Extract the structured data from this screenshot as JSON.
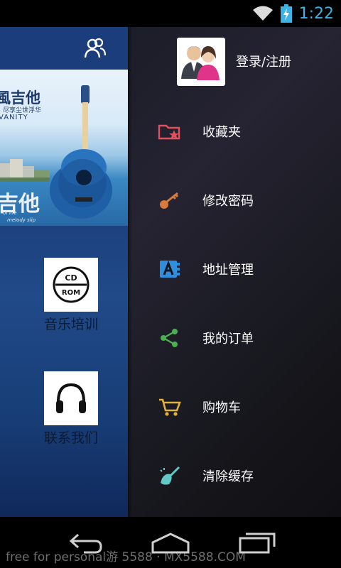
{
  "status_bar": {
    "time": "1:22",
    "icons": [
      "wifi-icon",
      "battery-charging-icon"
    ]
  },
  "main": {
    "header_icon": "user-group-icon",
    "banner": {
      "title": "風吉他",
      "sub1": "尽享尘世浮华",
      "sub2": "VANITY",
      "big": "吉他",
      "small1": "of life",
      "small2": "melody slip",
      "carousel": {
        "count": 3,
        "active": 0,
        "active_color": "#e53935"
      }
    },
    "tiles": [
      {
        "label": "音乐培训",
        "icon": "cd-rom-icon"
      },
      {
        "label": "联系我们",
        "icon": "headphones-icon"
      }
    ]
  },
  "drawer": {
    "login_label": "登录/注册",
    "avatar_icon": "couple-avatar-icon",
    "items": [
      {
        "label": "收藏夹",
        "icon": "favorites-folder-icon",
        "color": "#e0515e"
      },
      {
        "label": "修改密码",
        "icon": "key-icon",
        "color": "#d77a3b"
      },
      {
        "label": "地址管理",
        "icon": "address-book-icon",
        "color": "#2f8fde"
      },
      {
        "label": "我的订单",
        "icon": "share-icon",
        "color": "#4caf50"
      },
      {
        "label": "购物车",
        "icon": "cart-icon",
        "color": "#e0b23a"
      },
      {
        "label": "清除缓存",
        "icon": "broom-icon",
        "color": "#62c9c6"
      }
    ]
  },
  "nav_bar": {
    "buttons": [
      "back-icon",
      "home-icon",
      "recents-icon"
    ],
    "watermark": "free for personal游 5588 · MX5588.COM"
  }
}
